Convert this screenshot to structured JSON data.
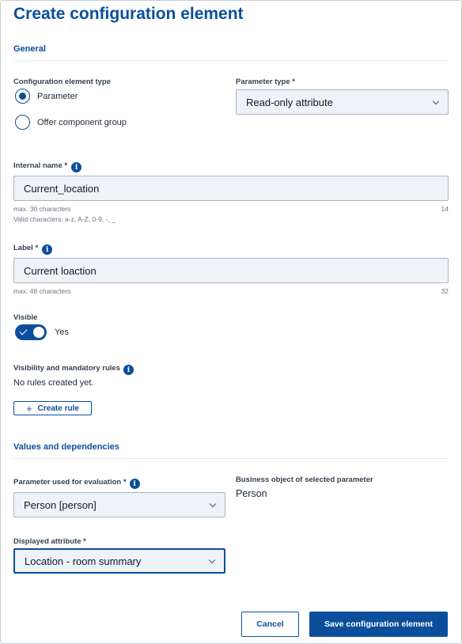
{
  "page": {
    "title": "Create configuration element"
  },
  "general": {
    "heading": "General",
    "element_type": {
      "label": "Configuration element type",
      "options": [
        {
          "label": "Parameter",
          "selected": true
        },
        {
          "label": "Offer component group",
          "selected": false
        }
      ]
    },
    "parameter_type": {
      "label": "Parameter type *",
      "value": "Read-only attribute"
    },
    "internal_name": {
      "label": "Internal name *",
      "value": "Current_location",
      "hint": "max. 30 characters",
      "valid_chars": "Valid characters: a-z, A-Z, 0-9, -, _",
      "count": "14"
    },
    "label_field": {
      "label": "Label *",
      "value": "Current loaction",
      "hint": "max. 48 characters",
      "count": "32"
    },
    "visible": {
      "label": "Visible",
      "state": "Yes"
    },
    "rules": {
      "label": "Visibility and mandatory rules",
      "empty": "No rules created yet.",
      "create_button": "Create rule"
    }
  },
  "values": {
    "heading": "Values and dependencies",
    "evaluation": {
      "label": "Parameter used for evaluation *",
      "value": "Person [person]"
    },
    "business_object": {
      "label": "Business object of selected parameter",
      "value": "Person"
    },
    "displayed_attribute": {
      "label": "Displayed attribute *",
      "value": "Location - room summary"
    }
  },
  "footer": {
    "cancel": "Cancel",
    "save": "Save configuration element"
  },
  "colors": {
    "primary": "#0b4f9c",
    "field_bg": "#eef3f8"
  },
  "icons": [
    "info-icon",
    "chevron-down-icon",
    "plus-icon",
    "check-icon"
  ]
}
